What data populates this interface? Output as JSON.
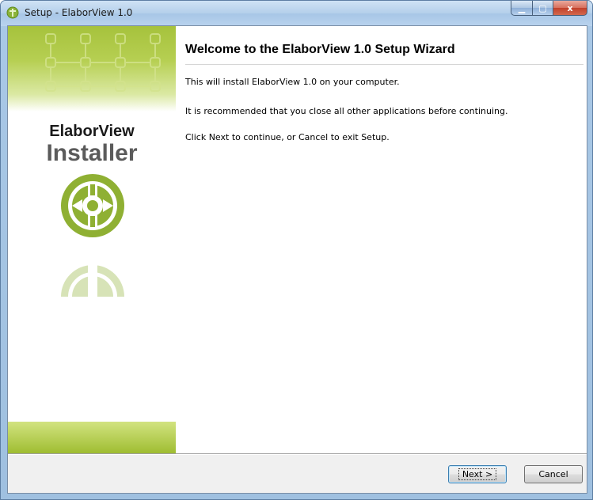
{
  "window": {
    "title": "Setup - ElaborView 1.0",
    "icon": "setup-app-icon",
    "minimize_glyph": "▁",
    "maximize_glyph": "▢",
    "close_glyph": "x"
  },
  "sidebar": {
    "brand_line1": "ElaborView",
    "brand_line2": "Installer",
    "accent_color": "#9ab83a"
  },
  "content": {
    "heading": "Welcome to the ElaborView 1.0 Setup Wizard",
    "paragraphs": [
      "This will install ElaborView 1.0 on your computer.",
      "It is recommended that you close all other applications before continuing.",
      "Click Next to continue, or Cancel to exit Setup."
    ]
  },
  "buttons": {
    "next_label": "Next >",
    "cancel_label": "Cancel"
  }
}
